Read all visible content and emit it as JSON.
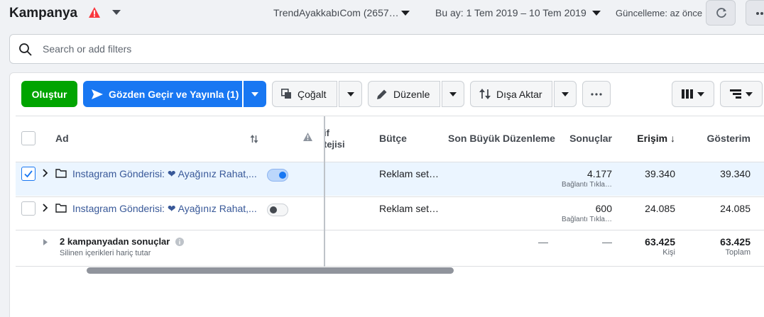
{
  "header": {
    "title": "Kampanya",
    "account": "TrendAyakkabıCom (2657…",
    "date_range": "Bu ay: 1 Tem 2019 – 10 Tem 2019",
    "update_status": "Güncelleme: az önce"
  },
  "search": {
    "placeholder": "Search or add filters"
  },
  "toolbar": {
    "create": "Oluştur",
    "review_publish": "Gözden Geçir ve Yayınla (1)",
    "duplicate": "Çoğalt",
    "edit": "Düzenle",
    "export": "Dışa Aktar"
  },
  "table": {
    "headers": {
      "name": "Ad",
      "delivery_top": "if",
      "delivery_bottom": "tejisi",
      "budget": "Bütçe",
      "last_edit": "Son Büyük Düzenleme",
      "results": "Sonuçlar",
      "reach": "Erişim ↓",
      "impressions": "Gösterim"
    },
    "rows": [
      {
        "name": "Instagram Gönderisi: ❤ Ayağınız Rahat,...",
        "budget": "Reklam set…",
        "results": "4.177",
        "results_sub": "Bağlantı Tıkla…",
        "reach": "39.340",
        "impressions": "39.340",
        "selected": true,
        "active": true
      },
      {
        "name": "Instagram Gönderisi: ❤ Ayağınız Rahat,...",
        "budget": "Reklam set…",
        "results": "600",
        "results_sub": "Bağlantı Tıkla…",
        "reach": "24.085",
        "impressions": "24.085",
        "selected": false,
        "active": false
      }
    ],
    "summary": {
      "title": "2 kampanyadan sonuçlar",
      "subtitle": "Silinen içerikleri hariç tutar",
      "last_edit": "—",
      "results": "—",
      "reach": "63.425",
      "reach_sub": "Kişi",
      "impressions": "63.425",
      "impressions_sub": "Toplam"
    }
  },
  "colors": {
    "primary": "#1877f2",
    "create": "#00a400",
    "warning": "#fa383e",
    "link": "#385898"
  }
}
